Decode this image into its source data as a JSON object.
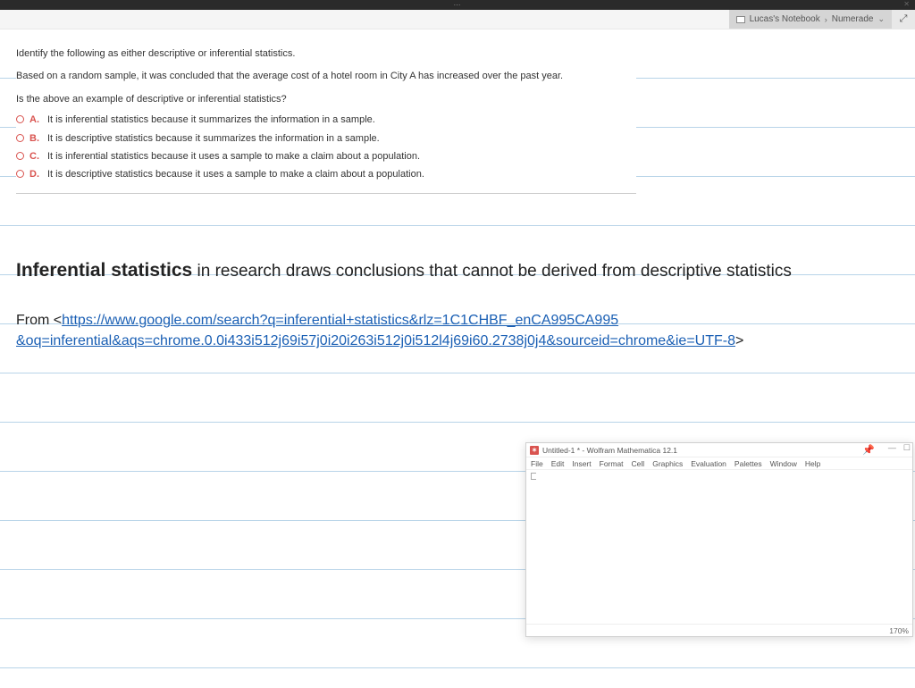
{
  "titlebar": {
    "dots": "⋯"
  },
  "breadcrumb": {
    "notebook": "Lucas's Notebook",
    "page": "Numerade"
  },
  "question": {
    "intro": "Identify the following as either descriptive or inferential statistics.",
    "scenario": "Based on a random sample, it was concluded that the average cost of a hotel room in City A has increased over the past year.",
    "prompt": "Is the above an example of descriptive or inferential statistics?",
    "options": [
      {
        "letter": "A.",
        "text": "It is inferential statistics because it summarizes the information in a sample."
      },
      {
        "letter": "B.",
        "text": "It is descriptive statistics because it summarizes the information in a sample."
      },
      {
        "letter": "C.",
        "text": "It is inferential statistics because it uses a sample to make a claim about a population."
      },
      {
        "letter": "D.",
        "text": "It is descriptive statistics because it uses a sample to make a claim about a population."
      }
    ]
  },
  "notes": {
    "line1_bold": "Inferential statistics",
    "line1_rest": " in research draws conclusions that cannot be derived from descriptive statistics",
    "from_label": "From <",
    "url_part1": "https://www.google.com/search?q=inferential+statistics&rlz=1C1CHBF_enCA995CA995",
    "url_part2": "&oq=inferential&aqs=chrome.0.0i433i512j69i57j0i20i263i512j0i512l4j69i60.2738j0j4&sourceid=chrome&ie=UTF-8",
    "close_angle": ">"
  },
  "mathematica": {
    "title": "Untitled-1 * - Wolfram Mathematica 12.1",
    "menu": [
      "File",
      "Edit",
      "Insert",
      "Format",
      "Cell",
      "Graphics",
      "Evaluation",
      "Palettes",
      "Window",
      "Help"
    ],
    "zoom": "170%"
  }
}
